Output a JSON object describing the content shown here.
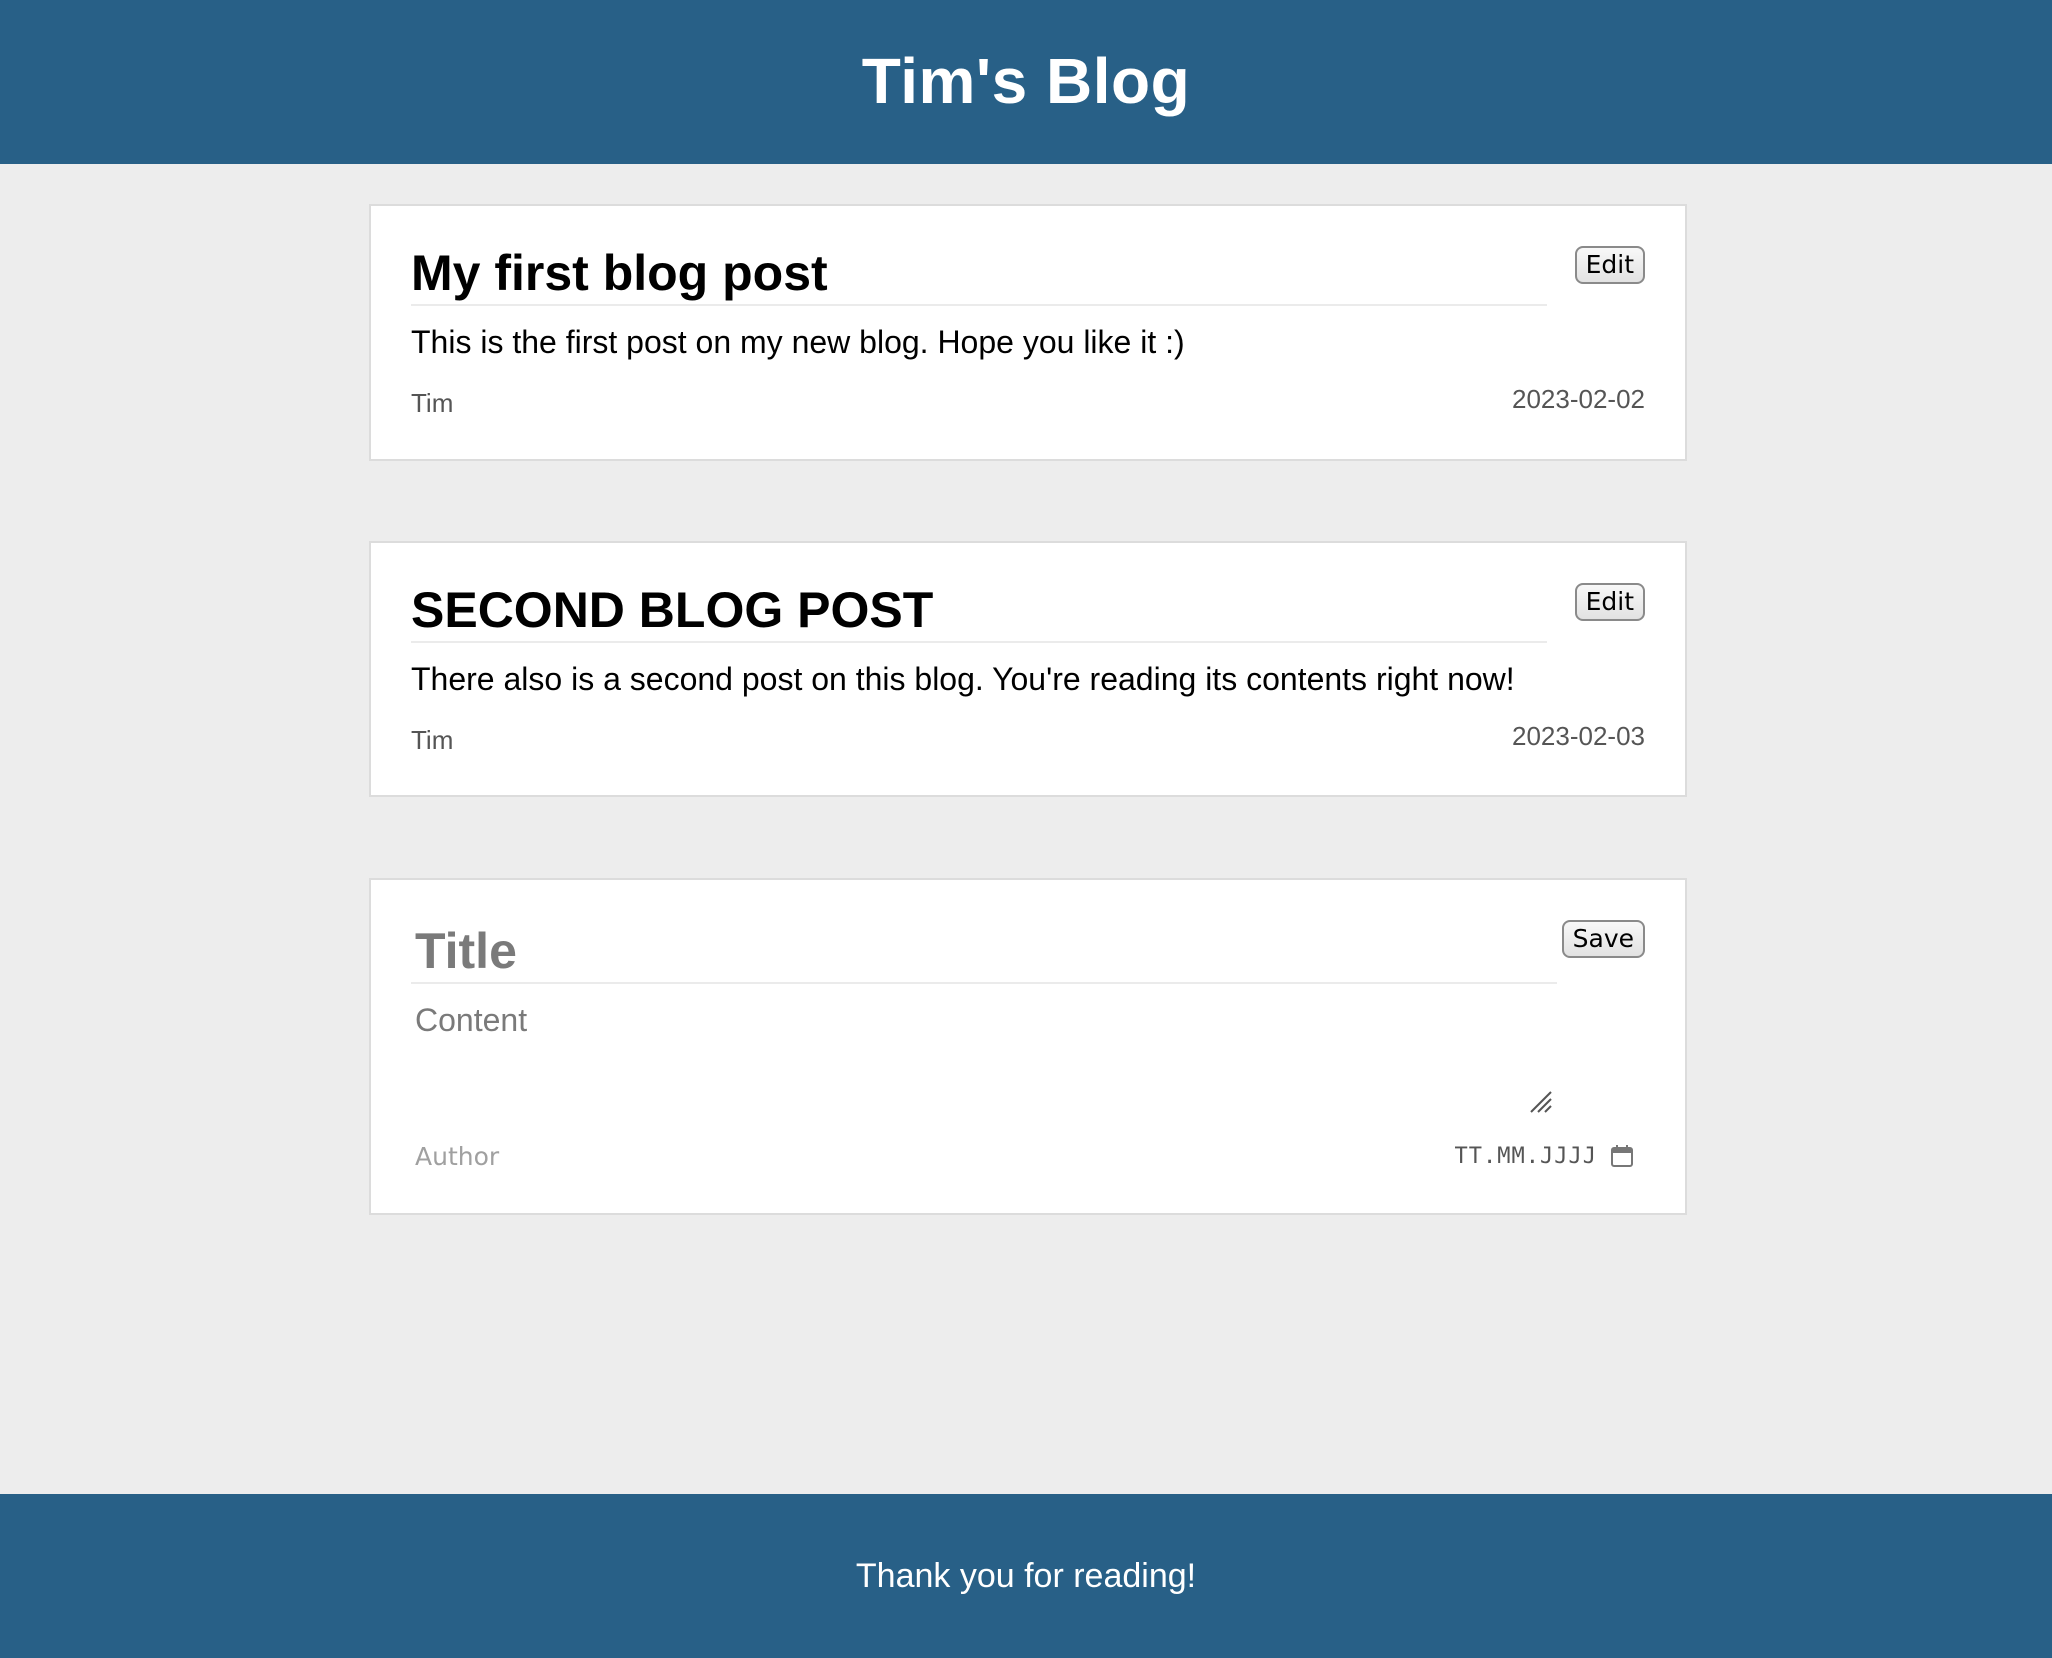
{
  "app": {
    "title": "Tim's Blog",
    "footer_text": "Thank you for reading!",
    "colors": {
      "header_bg": "#286087",
      "page_bg": "#ededed",
      "card_bg": "#ffffff"
    }
  },
  "posts": [
    {
      "title": "My first blog post",
      "content": "This is the first post on my new blog. Hope you like it :)",
      "author": "Tim",
      "date": "2023-02-02",
      "edit_label": "Edit"
    },
    {
      "title": "SECOND BLOG POST",
      "content": "There also is a second post on this blog. You're reading its contents right now!",
      "author": "Tim",
      "date": "2023-02-03",
      "edit_label": "Edit"
    }
  ],
  "editor": {
    "title_placeholder": "Title",
    "content_placeholder": "Content",
    "author_placeholder": "Author",
    "date_placeholder": "TT.MM.JJJJ",
    "save_label": "Save",
    "calendar_icon": "calendar-icon",
    "resize_icon": "resize-handle-icon"
  }
}
